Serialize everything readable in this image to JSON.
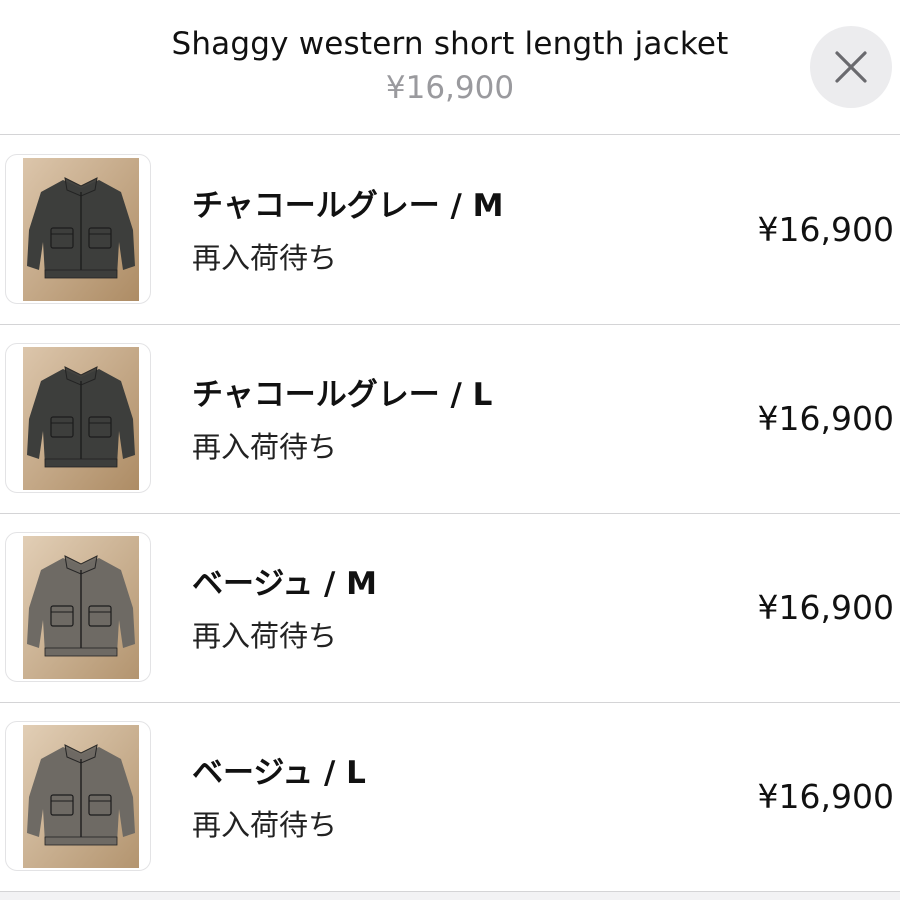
{
  "header": {
    "title": "Shaggy western short length jacket",
    "price": "¥16,900",
    "close_icon": "close-icon"
  },
  "variants": [
    {
      "name": "チャコールグレー / M",
      "status": "再入荷待ち",
      "price": "¥16,900",
      "thumb_icon": "jacket-photo",
      "jacket_color": "#3d3e3c",
      "bg_color": "#c9a77e"
    },
    {
      "name": "チャコールグレー / L",
      "status": "再入荷待ち",
      "price": "¥16,900",
      "thumb_icon": "jacket-photo",
      "jacket_color": "#3d3e3c",
      "bg_color": "#c9a77e"
    },
    {
      "name": "ベージュ / M",
      "status": "再入荷待ち",
      "price": "¥16,900",
      "thumb_icon": "jacket-photo",
      "jacket_color": "#6e6a64",
      "bg_color": "#d2b48e"
    },
    {
      "name": "ベージュ / L",
      "status": "再入荷待ち",
      "price": "¥16,900",
      "thumb_icon": "jacket-photo",
      "jacket_color": "#6e6a64",
      "bg_color": "#d2b48e"
    }
  ]
}
